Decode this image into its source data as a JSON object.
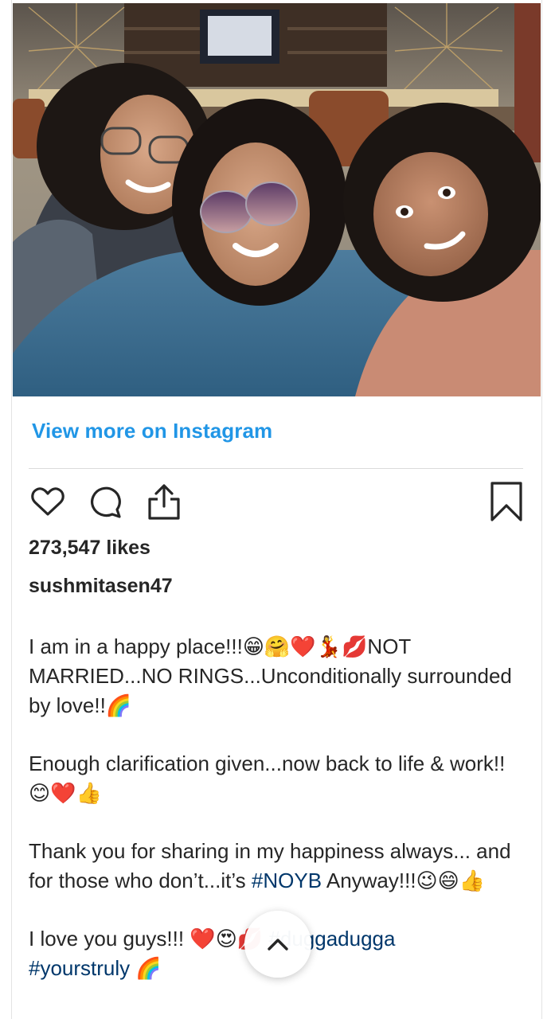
{
  "post": {
    "image_alt": "Three women smiling together in a selfie at a bar",
    "view_more": "View more on Instagram",
    "likes": "273,547 likes",
    "username": "sushmitasen47",
    "caption": {
      "p1": "I am in a happy place!!!😁🤗❤️💃💋NOT MARRIED...NO RINGS...Unconditionally surrounded by love!!🌈",
      "p2": "Enough clarification given...now back to life & work!!😊❤️👍",
      "p3_before": "Thank you for sharing in my happiness always... and for those who don’t...it’s ",
      "p3_tag": "#NOYB",
      "p3_after": " Anyway!!!😉😄👍",
      "p4_before": "I love you guys!!! ❤️😍💋 ",
      "p4_tag1": "#duggadugga",
      "p4_tag2": "#yourstruly",
      "p4_after": " 🌈"
    }
  },
  "icons": {
    "like": "heart-icon",
    "comment": "comment-icon",
    "share": "share-icon",
    "save": "bookmark-icon",
    "scroll_top": "chevron-up-icon"
  },
  "colors": {
    "link": "#2196e6",
    "hashtag": "#00376b",
    "text": "#262626"
  }
}
